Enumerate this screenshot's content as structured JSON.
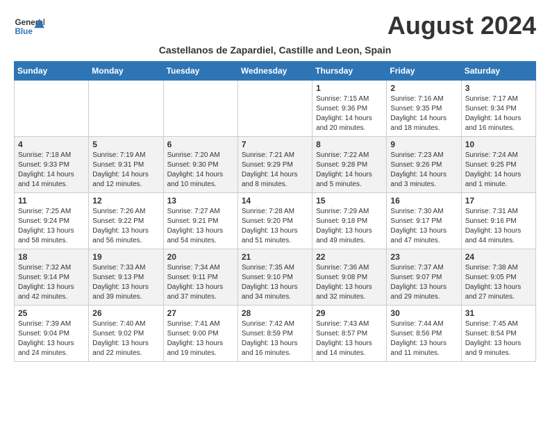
{
  "header": {
    "month_year": "August 2024",
    "subtitle": "Castellanos de Zapardiel, Castille and Leon, Spain",
    "logo_general": "General",
    "logo_blue": "Blue"
  },
  "days_of_week": [
    "Sunday",
    "Monday",
    "Tuesday",
    "Wednesday",
    "Thursday",
    "Friday",
    "Saturday"
  ],
  "weeks": [
    [
      {
        "day": "",
        "info": ""
      },
      {
        "day": "",
        "info": ""
      },
      {
        "day": "",
        "info": ""
      },
      {
        "day": "",
        "info": ""
      },
      {
        "day": "1",
        "info": "Sunrise: 7:15 AM\nSunset: 9:36 PM\nDaylight: 14 hours and 20 minutes."
      },
      {
        "day": "2",
        "info": "Sunrise: 7:16 AM\nSunset: 9:35 PM\nDaylight: 14 hours and 18 minutes."
      },
      {
        "day": "3",
        "info": "Sunrise: 7:17 AM\nSunset: 9:34 PM\nDaylight: 14 hours and 16 minutes."
      }
    ],
    [
      {
        "day": "4",
        "info": "Sunrise: 7:18 AM\nSunset: 9:33 PM\nDaylight: 14 hours and 14 minutes."
      },
      {
        "day": "5",
        "info": "Sunrise: 7:19 AM\nSunset: 9:31 PM\nDaylight: 14 hours and 12 minutes."
      },
      {
        "day": "6",
        "info": "Sunrise: 7:20 AM\nSunset: 9:30 PM\nDaylight: 14 hours and 10 minutes."
      },
      {
        "day": "7",
        "info": "Sunrise: 7:21 AM\nSunset: 9:29 PM\nDaylight: 14 hours and 8 minutes."
      },
      {
        "day": "8",
        "info": "Sunrise: 7:22 AM\nSunset: 9:28 PM\nDaylight: 14 hours and 5 minutes."
      },
      {
        "day": "9",
        "info": "Sunrise: 7:23 AM\nSunset: 9:26 PM\nDaylight: 14 hours and 3 minutes."
      },
      {
        "day": "10",
        "info": "Sunrise: 7:24 AM\nSunset: 9:25 PM\nDaylight: 14 hours and 1 minute."
      }
    ],
    [
      {
        "day": "11",
        "info": "Sunrise: 7:25 AM\nSunset: 9:24 PM\nDaylight: 13 hours and 58 minutes."
      },
      {
        "day": "12",
        "info": "Sunrise: 7:26 AM\nSunset: 9:22 PM\nDaylight: 13 hours and 56 minutes."
      },
      {
        "day": "13",
        "info": "Sunrise: 7:27 AM\nSunset: 9:21 PM\nDaylight: 13 hours and 54 minutes."
      },
      {
        "day": "14",
        "info": "Sunrise: 7:28 AM\nSunset: 9:20 PM\nDaylight: 13 hours and 51 minutes."
      },
      {
        "day": "15",
        "info": "Sunrise: 7:29 AM\nSunset: 9:18 PM\nDaylight: 13 hours and 49 minutes."
      },
      {
        "day": "16",
        "info": "Sunrise: 7:30 AM\nSunset: 9:17 PM\nDaylight: 13 hours and 47 minutes."
      },
      {
        "day": "17",
        "info": "Sunrise: 7:31 AM\nSunset: 9:16 PM\nDaylight: 13 hours and 44 minutes."
      }
    ],
    [
      {
        "day": "18",
        "info": "Sunrise: 7:32 AM\nSunset: 9:14 PM\nDaylight: 13 hours and 42 minutes."
      },
      {
        "day": "19",
        "info": "Sunrise: 7:33 AM\nSunset: 9:13 PM\nDaylight: 13 hours and 39 minutes."
      },
      {
        "day": "20",
        "info": "Sunrise: 7:34 AM\nSunset: 9:11 PM\nDaylight: 13 hours and 37 minutes."
      },
      {
        "day": "21",
        "info": "Sunrise: 7:35 AM\nSunset: 9:10 PM\nDaylight: 13 hours and 34 minutes."
      },
      {
        "day": "22",
        "info": "Sunrise: 7:36 AM\nSunset: 9:08 PM\nDaylight: 13 hours and 32 minutes."
      },
      {
        "day": "23",
        "info": "Sunrise: 7:37 AM\nSunset: 9:07 PM\nDaylight: 13 hours and 29 minutes."
      },
      {
        "day": "24",
        "info": "Sunrise: 7:38 AM\nSunset: 9:05 PM\nDaylight: 13 hours and 27 minutes."
      }
    ],
    [
      {
        "day": "25",
        "info": "Sunrise: 7:39 AM\nSunset: 9:04 PM\nDaylight: 13 hours and 24 minutes."
      },
      {
        "day": "26",
        "info": "Sunrise: 7:40 AM\nSunset: 9:02 PM\nDaylight: 13 hours and 22 minutes."
      },
      {
        "day": "27",
        "info": "Sunrise: 7:41 AM\nSunset: 9:00 PM\nDaylight: 13 hours and 19 minutes."
      },
      {
        "day": "28",
        "info": "Sunrise: 7:42 AM\nSunset: 8:59 PM\nDaylight: 13 hours and 16 minutes."
      },
      {
        "day": "29",
        "info": "Sunrise: 7:43 AM\nSunset: 8:57 PM\nDaylight: 13 hours and 14 minutes."
      },
      {
        "day": "30",
        "info": "Sunrise: 7:44 AM\nSunset: 8:56 PM\nDaylight: 13 hours and 11 minutes."
      },
      {
        "day": "31",
        "info": "Sunrise: 7:45 AM\nSunset: 8:54 PM\nDaylight: 13 hours and 9 minutes."
      }
    ]
  ]
}
